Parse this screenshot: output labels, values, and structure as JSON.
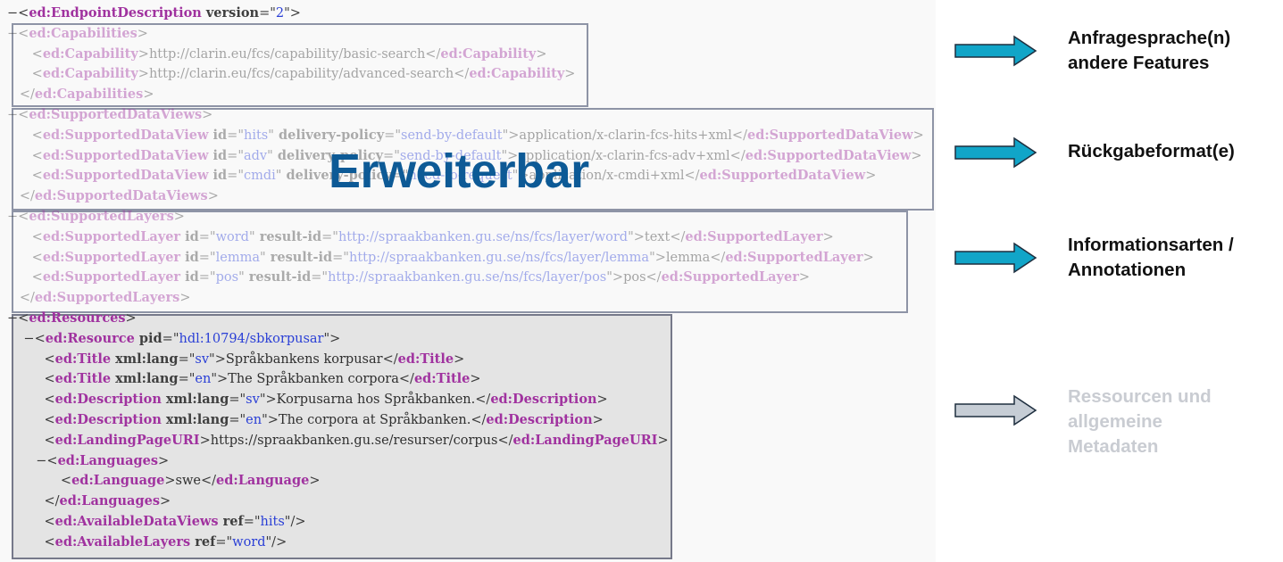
{
  "xml": {
    "lines": [
      {
        "fade": false,
        "segs": [
          {
            "c": "pu",
            "t": "−<"
          },
          {
            "c": "tg",
            "t": "ed:EndpointDescription"
          },
          {
            "c": "at",
            "t": " version"
          },
          {
            "c": "pu",
            "t": "=\""
          },
          {
            "c": "vl",
            "t": "2"
          },
          {
            "c": "pu",
            "t": "\">"
          }
        ]
      },
      {
        "fade": true,
        "segs": [
          {
            "c": "pu",
            "t": "−<"
          },
          {
            "c": "tg",
            "t": "ed:Capabilities"
          },
          {
            "c": "pu",
            "t": ">"
          }
        ]
      },
      {
        "fade": true,
        "segs": [
          {
            "c": "pu",
            "t": "      <"
          },
          {
            "c": "tg",
            "t": "ed:Capability"
          },
          {
            "c": "pu",
            "t": ">"
          },
          {
            "c": "tx",
            "t": "http://clarin.eu/fcs/capability/basic-search"
          },
          {
            "c": "pu",
            "t": "</"
          },
          {
            "c": "tg",
            "t": "ed:Capability"
          },
          {
            "c": "pu",
            "t": ">"
          }
        ]
      },
      {
        "fade": true,
        "segs": [
          {
            "c": "pu",
            "t": "      <"
          },
          {
            "c": "tg",
            "t": "ed:Capability"
          },
          {
            "c": "pu",
            "t": ">"
          },
          {
            "c": "tx",
            "t": "http://clarin.eu/fcs/capability/advanced-search"
          },
          {
            "c": "pu",
            "t": "</"
          },
          {
            "c": "tg",
            "t": "ed:Capability"
          },
          {
            "c": "pu",
            "t": ">"
          }
        ]
      },
      {
        "fade": true,
        "segs": [
          {
            "c": "pu",
            "t": "   </"
          },
          {
            "c": "tg",
            "t": "ed:Capabilities"
          },
          {
            "c": "pu",
            "t": ">"
          }
        ]
      },
      {
        "fade": true,
        "segs": [
          {
            "c": "pu",
            "t": "−<"
          },
          {
            "c": "tg",
            "t": "ed:SupportedDataViews"
          },
          {
            "c": "pu",
            "t": ">"
          }
        ]
      },
      {
        "fade": true,
        "segs": [
          {
            "c": "pu",
            "t": "      <"
          },
          {
            "c": "tg",
            "t": "ed:SupportedDataView"
          },
          {
            "c": "at",
            "t": " id"
          },
          {
            "c": "pu",
            "t": "=\""
          },
          {
            "c": "vl",
            "t": "hits"
          },
          {
            "c": "pu",
            "t": "\""
          },
          {
            "c": "at",
            "t": " delivery-policy"
          },
          {
            "c": "pu",
            "t": "=\""
          },
          {
            "c": "vl",
            "t": "send-by-default"
          },
          {
            "c": "pu",
            "t": "\">"
          },
          {
            "c": "tx",
            "t": "application/x-clarin-fcs-hits+xml"
          },
          {
            "c": "pu",
            "t": "</"
          },
          {
            "c": "tg",
            "t": "ed:SupportedDataView"
          },
          {
            "c": "pu",
            "t": ">"
          }
        ]
      },
      {
        "fade": true,
        "segs": [
          {
            "c": "pu",
            "t": "      <"
          },
          {
            "c": "tg",
            "t": "ed:SupportedDataView"
          },
          {
            "c": "at",
            "t": " id"
          },
          {
            "c": "pu",
            "t": "=\""
          },
          {
            "c": "vl",
            "t": "adv"
          },
          {
            "c": "pu",
            "t": "\""
          },
          {
            "c": "at",
            "t": " delivery-policy"
          },
          {
            "c": "pu",
            "t": "=\""
          },
          {
            "c": "vl",
            "t": "send-by-default"
          },
          {
            "c": "pu",
            "t": "\">"
          },
          {
            "c": "tx",
            "t": "application/x-clarin-fcs-adv+xml"
          },
          {
            "c": "pu",
            "t": "</"
          },
          {
            "c": "tg",
            "t": "ed:SupportedDataView"
          },
          {
            "c": "pu",
            "t": ">"
          }
        ]
      },
      {
        "fade": true,
        "segs": [
          {
            "c": "pu",
            "t": "      <"
          },
          {
            "c": "tg",
            "t": "ed:SupportedDataView"
          },
          {
            "c": "at",
            "t": " id"
          },
          {
            "c": "pu",
            "t": "=\""
          },
          {
            "c": "vl",
            "t": "cmdi"
          },
          {
            "c": "pu",
            "t": "\""
          },
          {
            "c": "at",
            "t": " delivery-policy"
          },
          {
            "c": "pu",
            "t": "=\""
          },
          {
            "c": "vl",
            "t": "need-to-request"
          },
          {
            "c": "pu",
            "t": "\">"
          },
          {
            "c": "tx",
            "t": "application/x-cmdi+xml"
          },
          {
            "c": "pu",
            "t": "</"
          },
          {
            "c": "tg",
            "t": "ed:SupportedDataView"
          },
          {
            "c": "pu",
            "t": ">"
          }
        ]
      },
      {
        "fade": true,
        "segs": [
          {
            "c": "pu",
            "t": "   </"
          },
          {
            "c": "tg",
            "t": "ed:SupportedDataViews"
          },
          {
            "c": "pu",
            "t": ">"
          }
        ]
      },
      {
        "fade": true,
        "segs": [
          {
            "c": "pu",
            "t": "−<"
          },
          {
            "c": "tg",
            "t": "ed:SupportedLayers"
          },
          {
            "c": "pu",
            "t": ">"
          }
        ]
      },
      {
        "fade": true,
        "segs": [
          {
            "c": "pu",
            "t": "      <"
          },
          {
            "c": "tg",
            "t": "ed:SupportedLayer"
          },
          {
            "c": "at",
            "t": " id"
          },
          {
            "c": "pu",
            "t": "=\""
          },
          {
            "c": "vl",
            "t": "word"
          },
          {
            "c": "pu",
            "t": "\""
          },
          {
            "c": "at",
            "t": " result-id"
          },
          {
            "c": "pu",
            "t": "=\""
          },
          {
            "c": "vl",
            "t": "http://spraakbanken.gu.se/ns/fcs/layer/word"
          },
          {
            "c": "pu",
            "t": "\">"
          },
          {
            "c": "tx",
            "t": "text"
          },
          {
            "c": "pu",
            "t": "</"
          },
          {
            "c": "tg",
            "t": "ed:SupportedLayer"
          },
          {
            "c": "pu",
            "t": ">"
          }
        ]
      },
      {
        "fade": true,
        "segs": [
          {
            "c": "pu",
            "t": "      <"
          },
          {
            "c": "tg",
            "t": "ed:SupportedLayer"
          },
          {
            "c": "at",
            "t": " id"
          },
          {
            "c": "pu",
            "t": "=\""
          },
          {
            "c": "vl",
            "t": "lemma"
          },
          {
            "c": "pu",
            "t": "\""
          },
          {
            "c": "at",
            "t": " result-id"
          },
          {
            "c": "pu",
            "t": "=\""
          },
          {
            "c": "vl",
            "t": "http://spraakbanken.gu.se/ns/fcs/layer/lemma"
          },
          {
            "c": "pu",
            "t": "\">"
          },
          {
            "c": "tx",
            "t": "lemma"
          },
          {
            "c": "pu",
            "t": "</"
          },
          {
            "c": "tg",
            "t": "ed:SupportedLayer"
          },
          {
            "c": "pu",
            "t": ">"
          }
        ]
      },
      {
        "fade": true,
        "segs": [
          {
            "c": "pu",
            "t": "      <"
          },
          {
            "c": "tg",
            "t": "ed:SupportedLayer"
          },
          {
            "c": "at",
            "t": " id"
          },
          {
            "c": "pu",
            "t": "=\""
          },
          {
            "c": "vl",
            "t": "pos"
          },
          {
            "c": "pu",
            "t": "\""
          },
          {
            "c": "at",
            "t": " result-id"
          },
          {
            "c": "pu",
            "t": "=\""
          },
          {
            "c": "vl",
            "t": "http://spraakbanken.gu.se/ns/fcs/layer/pos"
          },
          {
            "c": "pu",
            "t": "\">"
          },
          {
            "c": "tx",
            "t": "pos"
          },
          {
            "c": "pu",
            "t": "</"
          },
          {
            "c": "tg",
            "t": "ed:SupportedLayer"
          },
          {
            "c": "pu",
            "t": ">"
          }
        ]
      },
      {
        "fade": true,
        "segs": [
          {
            "c": "pu",
            "t": "   </"
          },
          {
            "c": "tg",
            "t": "ed:SupportedLayers"
          },
          {
            "c": "pu",
            "t": ">"
          }
        ]
      },
      {
        "fade": false,
        "segs": [
          {
            "c": "pu",
            "t": "−<"
          },
          {
            "c": "tg",
            "t": "ed:Resources"
          },
          {
            "c": "pu",
            "t": ">"
          }
        ]
      },
      {
        "fade": false,
        "segs": [
          {
            "c": "pu",
            "t": "    −<"
          },
          {
            "c": "tg",
            "t": "ed:Resource"
          },
          {
            "c": "at",
            "t": " pid"
          },
          {
            "c": "pu",
            "t": "=\""
          },
          {
            "c": "vl",
            "t": "hdl:10794/sbkorpusar"
          },
          {
            "c": "pu",
            "t": "\">"
          }
        ]
      },
      {
        "fade": false,
        "segs": [
          {
            "c": "pu",
            "t": "         <"
          },
          {
            "c": "tg",
            "t": "ed:Title"
          },
          {
            "c": "at",
            "t": " xml:lang"
          },
          {
            "c": "pu",
            "t": "=\""
          },
          {
            "c": "vl",
            "t": "sv"
          },
          {
            "c": "pu",
            "t": "\">"
          },
          {
            "c": "tx",
            "t": "Språkbankens korpusar"
          },
          {
            "c": "pu",
            "t": "</"
          },
          {
            "c": "tg",
            "t": "ed:Title"
          },
          {
            "c": "pu",
            "t": ">"
          }
        ]
      },
      {
        "fade": false,
        "segs": [
          {
            "c": "pu",
            "t": "         <"
          },
          {
            "c": "tg",
            "t": "ed:Title"
          },
          {
            "c": "at",
            "t": " xml:lang"
          },
          {
            "c": "pu",
            "t": "=\""
          },
          {
            "c": "vl",
            "t": "en"
          },
          {
            "c": "pu",
            "t": "\">"
          },
          {
            "c": "tx",
            "t": "The Språkbanken corpora"
          },
          {
            "c": "pu",
            "t": "</"
          },
          {
            "c": "tg",
            "t": "ed:Title"
          },
          {
            "c": "pu",
            "t": ">"
          }
        ]
      },
      {
        "fade": false,
        "segs": [
          {
            "c": "pu",
            "t": "         <"
          },
          {
            "c": "tg",
            "t": "ed:Description"
          },
          {
            "c": "at",
            "t": " xml:lang"
          },
          {
            "c": "pu",
            "t": "=\""
          },
          {
            "c": "vl",
            "t": "sv"
          },
          {
            "c": "pu",
            "t": "\">"
          },
          {
            "c": "tx",
            "t": "Korpusarna hos Språkbanken."
          },
          {
            "c": "pu",
            "t": "</"
          },
          {
            "c": "tg",
            "t": "ed:Description"
          },
          {
            "c": "pu",
            "t": ">"
          }
        ]
      },
      {
        "fade": false,
        "segs": [
          {
            "c": "pu",
            "t": "         <"
          },
          {
            "c": "tg",
            "t": "ed:Description"
          },
          {
            "c": "at",
            "t": " xml:lang"
          },
          {
            "c": "pu",
            "t": "=\""
          },
          {
            "c": "vl",
            "t": "en"
          },
          {
            "c": "pu",
            "t": "\">"
          },
          {
            "c": "tx",
            "t": "The corpora at Språkbanken."
          },
          {
            "c": "pu",
            "t": "</"
          },
          {
            "c": "tg",
            "t": "ed:Description"
          },
          {
            "c": "pu",
            "t": ">"
          }
        ]
      },
      {
        "fade": false,
        "segs": [
          {
            "c": "pu",
            "t": "         <"
          },
          {
            "c": "tg",
            "t": "ed:LandingPageURI"
          },
          {
            "c": "pu",
            "t": ">"
          },
          {
            "c": "tx",
            "t": "https://spraakbanken.gu.se/resurser/corpus"
          },
          {
            "c": "pu",
            "t": "</"
          },
          {
            "c": "tg",
            "t": "ed:LandingPageURI"
          },
          {
            "c": "pu",
            "t": ">"
          }
        ]
      },
      {
        "fade": false,
        "segs": [
          {
            "c": "pu",
            "t": "       −<"
          },
          {
            "c": "tg",
            "t": "ed:Languages"
          },
          {
            "c": "pu",
            "t": ">"
          }
        ]
      },
      {
        "fade": false,
        "segs": [
          {
            "c": "pu",
            "t": "             <"
          },
          {
            "c": "tg",
            "t": "ed:Language"
          },
          {
            "c": "pu",
            "t": ">"
          },
          {
            "c": "tx",
            "t": "swe"
          },
          {
            "c": "pu",
            "t": "</"
          },
          {
            "c": "tg",
            "t": "ed:Language"
          },
          {
            "c": "pu",
            "t": ">"
          }
        ]
      },
      {
        "fade": false,
        "segs": [
          {
            "c": "pu",
            "t": "         </"
          },
          {
            "c": "tg",
            "t": "ed:Languages"
          },
          {
            "c": "pu",
            "t": ">"
          }
        ]
      },
      {
        "fade": false,
        "segs": [
          {
            "c": "pu",
            "t": "         <"
          },
          {
            "c": "tg",
            "t": "ed:AvailableDataViews"
          },
          {
            "c": "at",
            "t": " ref"
          },
          {
            "c": "pu",
            "t": "=\""
          },
          {
            "c": "vl",
            "t": "hits"
          },
          {
            "c": "pu",
            "t": "\"/>"
          }
        ]
      },
      {
        "fade": false,
        "segs": [
          {
            "c": "pu",
            "t": "         <"
          },
          {
            "c": "tg",
            "t": "ed:AvailableLayers"
          },
          {
            "c": "at",
            "t": " ref"
          },
          {
            "c": "pu",
            "t": "=\""
          },
          {
            "c": "vl",
            "t": "word"
          },
          {
            "c": "pu",
            "t": "\"/>"
          }
        ]
      }
    ]
  },
  "watermark": "Erweiterbar",
  "callouts": [
    {
      "lines": [
        "Anfragesprache(n)",
        "andere Features"
      ],
      "arrow_color": "#11a5c8",
      "dim": false
    },
    {
      "lines": [
        "Rückgabeformat(e)"
      ],
      "arrow_color": "#11a5c8",
      "dim": false
    },
    {
      "lines": [
        "Informationsarten /",
        "Annotationen"
      ],
      "arrow_color": "#11a5c8",
      "dim": false
    },
    {
      "lines": [
        "Ressourcen und",
        "allgemeine",
        "Metadaten"
      ],
      "arrow_color": "#c6cdd5",
      "dim": true
    }
  ]
}
